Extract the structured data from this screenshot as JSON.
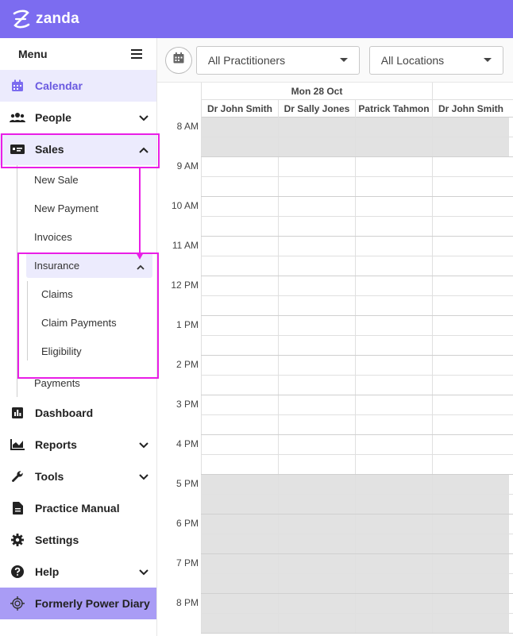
{
  "app": {
    "logo_text": "zanda"
  },
  "sidebar": {
    "menu_label": "Menu",
    "items": [
      {
        "label": "Calendar",
        "icon": "calendar-icon"
      },
      {
        "label": "People",
        "icon": "people-icon"
      },
      {
        "label": "Sales",
        "icon": "sales-icon"
      },
      {
        "label": "Dashboard",
        "icon": "dashboard-icon"
      },
      {
        "label": "Reports",
        "icon": "reports-icon"
      },
      {
        "label": "Tools",
        "icon": "tools-icon"
      },
      {
        "label": "Practice Manual",
        "icon": "manual-icon"
      },
      {
        "label": "Settings",
        "icon": "gear-icon"
      },
      {
        "label": "Help",
        "icon": "help-icon"
      },
      {
        "label": "Formerly Power Diary",
        "icon": "powerdiary-icon"
      }
    ],
    "sales_sub": [
      "New Sale",
      "New Payment",
      "Invoices",
      "Insurance",
      "Payments"
    ],
    "insurance_sub": [
      "Claims",
      "Claim Payments",
      "Eligibility"
    ]
  },
  "toolbar": {
    "practitioners_value": "All Practitioners",
    "locations_value": "All Locations"
  },
  "calendar": {
    "day_label": "Mon 28 Oct",
    "practitioners": [
      "Dr John Smith",
      "Dr Sally Jones",
      "Patrick Tahmon",
      "Dr John Smith"
    ],
    "times": [
      "8 AM",
      "9 AM",
      "10 AM",
      "11 AM",
      "12 PM",
      "1 PM",
      "2 PM",
      "3 PM",
      "4 PM",
      "5 PM",
      "6 PM",
      "7 PM",
      "8 PM"
    ]
  },
  "colors": {
    "brand": "#7c6cf0",
    "highlight": "#e91ee6",
    "active_bg": "#ecebfd"
  }
}
